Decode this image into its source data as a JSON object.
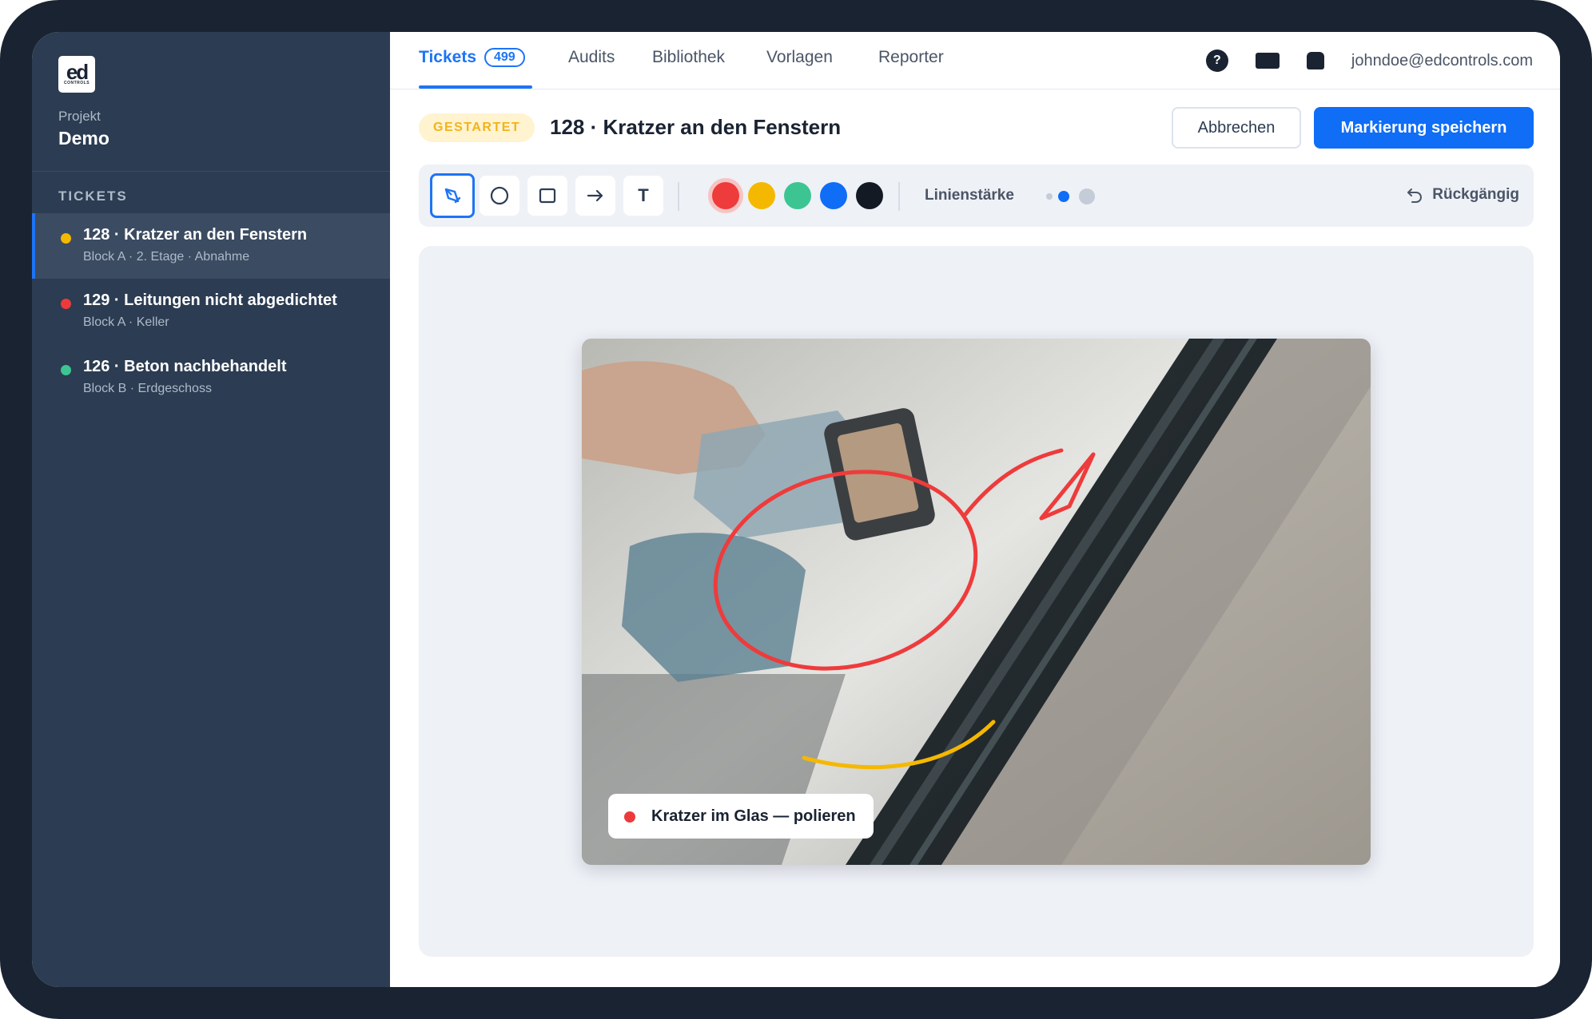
{
  "brand": {
    "logo_text": "ed",
    "logo_sub": "CONTROLS"
  },
  "sidebar": {
    "project_label": "Projekt",
    "project_name": "Demo",
    "section_label": "TICKETS",
    "items": [
      {
        "title": "128 · Kratzer an den Fenstern",
        "subtitle": "Block A · 2. Etage · Abnahme",
        "status_color": "#f5b800",
        "active": true
      },
      {
        "title": "129 · Leitungen nicht abgedichtet",
        "subtitle": "Block A · Keller",
        "status_color": "#ec3a3a",
        "active": false
      },
      {
        "title": "126 · Beton nachbehandelt",
        "subtitle": "Block B · Erdgeschoss",
        "status_color": "#3cc593",
        "active": false
      }
    ]
  },
  "nav": {
    "tabs": [
      {
        "label": "Tickets",
        "badge": "499",
        "active": true
      },
      {
        "label": "Audits"
      },
      {
        "label": "Bibliothek"
      },
      {
        "label": "Vorlagen"
      },
      {
        "label": "Reporter"
      }
    ],
    "help_icon_text": "?",
    "user_email": "johndoe@edcontrols.com"
  },
  "header": {
    "status_badge": "GESTARTET",
    "ticket_title": "128 · Kratzer an den Fenstern",
    "cancel_label": "Abbrechen",
    "save_label": "Markierung speichern"
  },
  "toolbar": {
    "tools": [
      "pen-tool",
      "circle-tool",
      "rectangle-tool",
      "arrow-tool",
      "text-tool"
    ],
    "active_tool": "pen-tool",
    "text_tool_glyph": "T",
    "colors": [
      "#ee3b3b",
      "#f5b800",
      "#3cc593",
      "#0f6df6",
      "#141a24"
    ],
    "selected_color": "#ee3b3b",
    "line_width_label": "Linienstärke",
    "line_widths": [
      "thin",
      "medium",
      "thick"
    ],
    "selected_line_width": "medium",
    "undo_label": "Rückgängig"
  },
  "canvas": {
    "annotation_label": "Kratzer im Glas — polieren",
    "annotation_color": "#ec3a3a",
    "marks": [
      {
        "type": "ellipse-with-arrow",
        "color": "#ee3b3b"
      },
      {
        "type": "curve",
        "color": "#f5b800"
      }
    ]
  }
}
